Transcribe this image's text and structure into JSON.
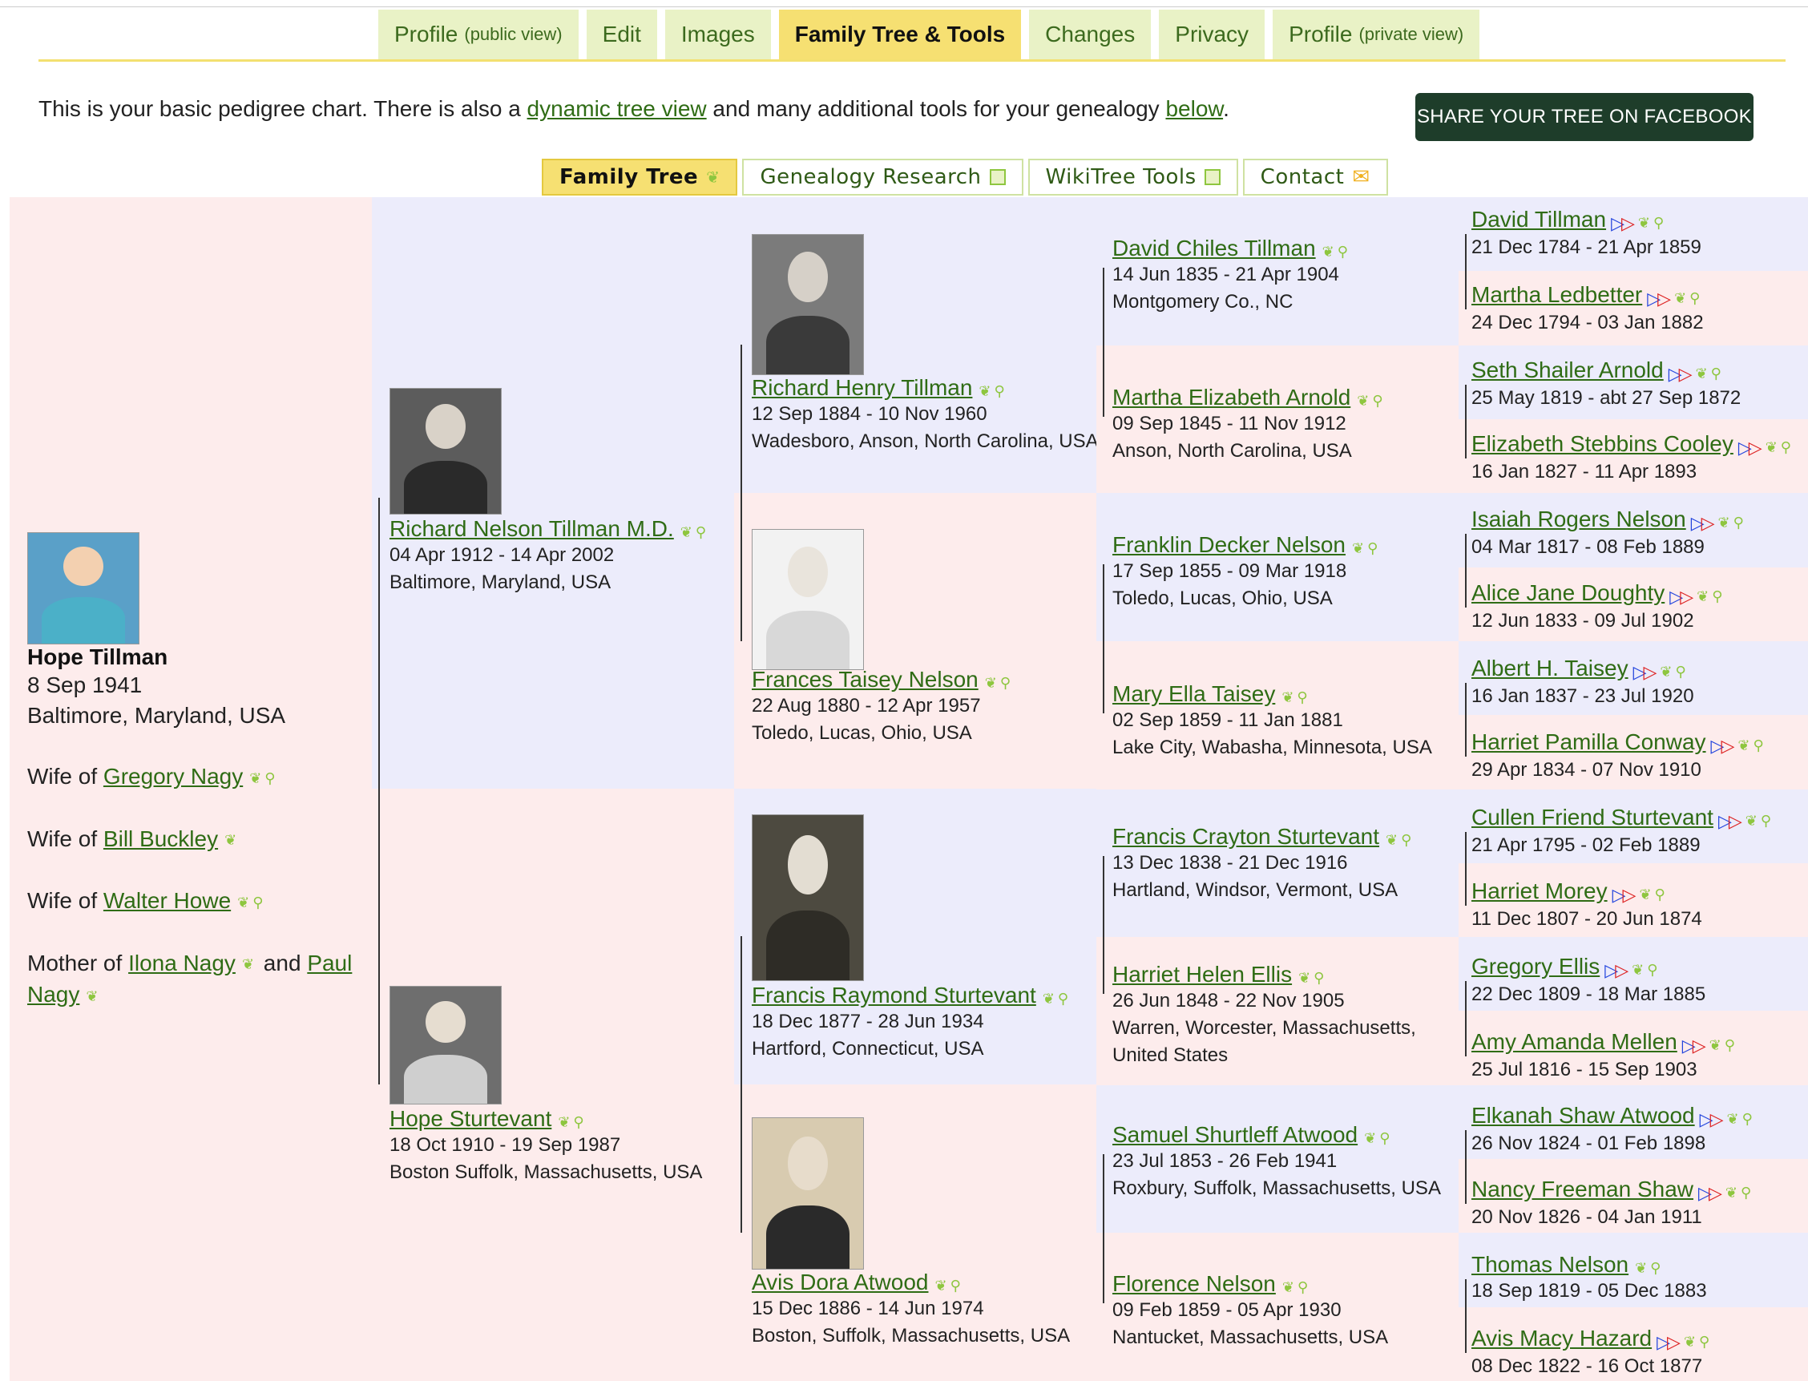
{
  "tabs": [
    {
      "label": "Profile",
      "small": "(public view)"
    },
    {
      "label": "Edit",
      "small": ""
    },
    {
      "label": "Images",
      "small": ""
    },
    {
      "label": "Family Tree & Tools",
      "small": ""
    },
    {
      "label": "Changes",
      "small": ""
    },
    {
      "label": "Privacy",
      "small": ""
    },
    {
      "label": "Profile",
      "small": "(private view)"
    }
  ],
  "intro": {
    "pre": "This is your basic pedigree chart. There is also a ",
    "link1": "dynamic tree view",
    "mid": " and many additional tools for your genealogy ",
    "link2": "below",
    "post": "."
  },
  "share_button": "SHARE YOUR TREE ON FACEBOOK",
  "subtabs": [
    "Family Tree",
    "Genealogy Research",
    "WikiTree Tools",
    "Contact"
  ],
  "colors": {
    "pink": "#fdecec",
    "blue": "#ececfb",
    "link": "#2f6c15",
    "active_tab": "#f6e072"
  },
  "root": {
    "name": "Hope Tillman",
    "date": "8 Sep 1941",
    "place": "Baltimore, Maryland, USA",
    "wife_prefix": "Wife of ",
    "spouses": [
      "Gregory Nagy",
      "Bill Buckley",
      "Walter Howe"
    ],
    "mother_prefix": "Mother of ",
    "children": [
      "Ilona Nagy",
      "Paul Nagy"
    ],
    "and": " and "
  },
  "gen1": [
    {
      "name": "Richard Nelson Tillman M.D.",
      "dates": "04 Apr 1912 - 14 Apr 2002",
      "place": "Baltimore, Maryland, USA"
    },
    {
      "name": "Hope Sturtevant",
      "dates": "18 Oct 1910 - 19 Sep 1987",
      "place": "Boston Suffolk, Massachusetts, USA"
    }
  ],
  "gen2": [
    {
      "name": "Richard Henry Tillman",
      "dates": "12 Sep 1884 - 10 Nov 1960",
      "place": "Wadesboro, Anson, North Carolina, USA"
    },
    {
      "name": "Frances Taisey Nelson",
      "dates": "22 Aug 1880 - 12 Apr 1957",
      "place": "Toledo, Lucas, Ohio, USA"
    },
    {
      "name": "Francis Raymond Sturtevant",
      "dates": "18 Dec 1877 - 28 Jun 1934",
      "place": "Hartford, Connecticut, USA"
    },
    {
      "name": "Avis Dora Atwood",
      "dates": "15 Dec 1886 - 14 Jun 1974",
      "place": "Boston, Suffolk, Massachusetts, USA"
    }
  ],
  "gen3": [
    {
      "name": "David Chiles Tillman",
      "dates": "14 Jun 1835 - 21 Apr 1904",
      "place": "Montgomery Co., NC",
      "place2": ""
    },
    {
      "name": "Martha Elizabeth Arnold",
      "dates": "09 Sep 1845 - 11 Nov 1912",
      "place": "Anson, North Carolina, USA",
      "place2": ""
    },
    {
      "name": "Franklin Decker Nelson",
      "dates": "17 Sep 1855 - 09 Mar 1918",
      "place": "Toledo, Lucas, Ohio, USA",
      "place2": ""
    },
    {
      "name": "Mary Ella Taisey",
      "dates": "02 Sep 1859 - 11 Jan 1881",
      "place": "Lake City, Wabasha, Minnesota, USA",
      "place2": ""
    },
    {
      "name": "Francis Crayton Sturtevant",
      "dates": "13 Dec 1838 - 21 Dec 1916",
      "place": "Hartland, Windsor, Vermont, USA",
      "place2": ""
    },
    {
      "name": "Harriet Helen Ellis",
      "dates": "26 Jun 1848 - 22 Nov 1905",
      "place": "Warren, Worcester, Massachusetts,",
      "place2": "United States"
    },
    {
      "name": "Samuel Shurtleff Atwood",
      "dates": "23 Jul 1853 - 26 Feb 1941",
      "place": "Roxbury, Suffolk, Massachusetts, USA",
      "place2": ""
    },
    {
      "name": "Florence Nelson",
      "dates": "09 Feb 1859 - 05 Apr 1930",
      "place": "Nantucket, Massachusetts, USA",
      "place2": ""
    }
  ],
  "gen4": [
    {
      "name": "David Tillman",
      "dates": "21 Dec 1784 - 21 Apr 1859",
      "arrow": true
    },
    {
      "name": "Martha Ledbetter",
      "dates": "24 Dec 1794 - 03 Jan 1882",
      "arrow": true
    },
    {
      "name": "Seth Shailer Arnold",
      "dates": "25 May 1819 - abt 27 Sep 1872",
      "arrow": true
    },
    {
      "name": "Elizabeth Stebbins Cooley",
      "dates": "16 Jan 1827 - 11 Apr 1893",
      "arrow": true
    },
    {
      "name": "Isaiah Rogers Nelson",
      "dates": "04 Mar 1817 - 08 Feb 1889",
      "arrow": true
    },
    {
      "name": "Alice Jane Doughty",
      "dates": "12 Jun 1833 - 09 Jul 1902",
      "arrow": true
    },
    {
      "name": "Albert H. Taisey",
      "dates": "16 Jan 1837 - 23 Jul 1920",
      "arrow": true
    },
    {
      "name": "Harriet Pamilla Conway",
      "dates": "29 Apr 1834 - 07 Nov 1910",
      "arrow": true
    },
    {
      "name": "Cullen Friend Sturtevant",
      "dates": "21 Apr 1795 - 02 Feb 1889",
      "arrow": true
    },
    {
      "name": "Harriet Morey",
      "dates": "11 Dec 1807 - 20 Jun 1874",
      "arrow": true
    },
    {
      "name": "Gregory Ellis",
      "dates": "22 Dec 1809 - 18 Mar 1885",
      "arrow": true
    },
    {
      "name": "Amy Amanda Mellen",
      "dates": "25 Jul 1816 - 15 Sep 1903",
      "arrow": true
    },
    {
      "name": "Elkanah Shaw Atwood",
      "dates": "26 Nov 1824 - 01 Feb 1898",
      "arrow": true
    },
    {
      "name": "Nancy Freeman Shaw",
      "dates": "20 Nov 1826 - 04 Jan 1911",
      "arrow": true
    },
    {
      "name": "Thomas Nelson",
      "dates": "18 Sep 1819 - 05 Dec 1883",
      "arrow": false
    },
    {
      "name": "Avis Macy Hazard",
      "dates": "08 Dec 1822 - 16 Oct 1877",
      "arrow": true
    }
  ]
}
